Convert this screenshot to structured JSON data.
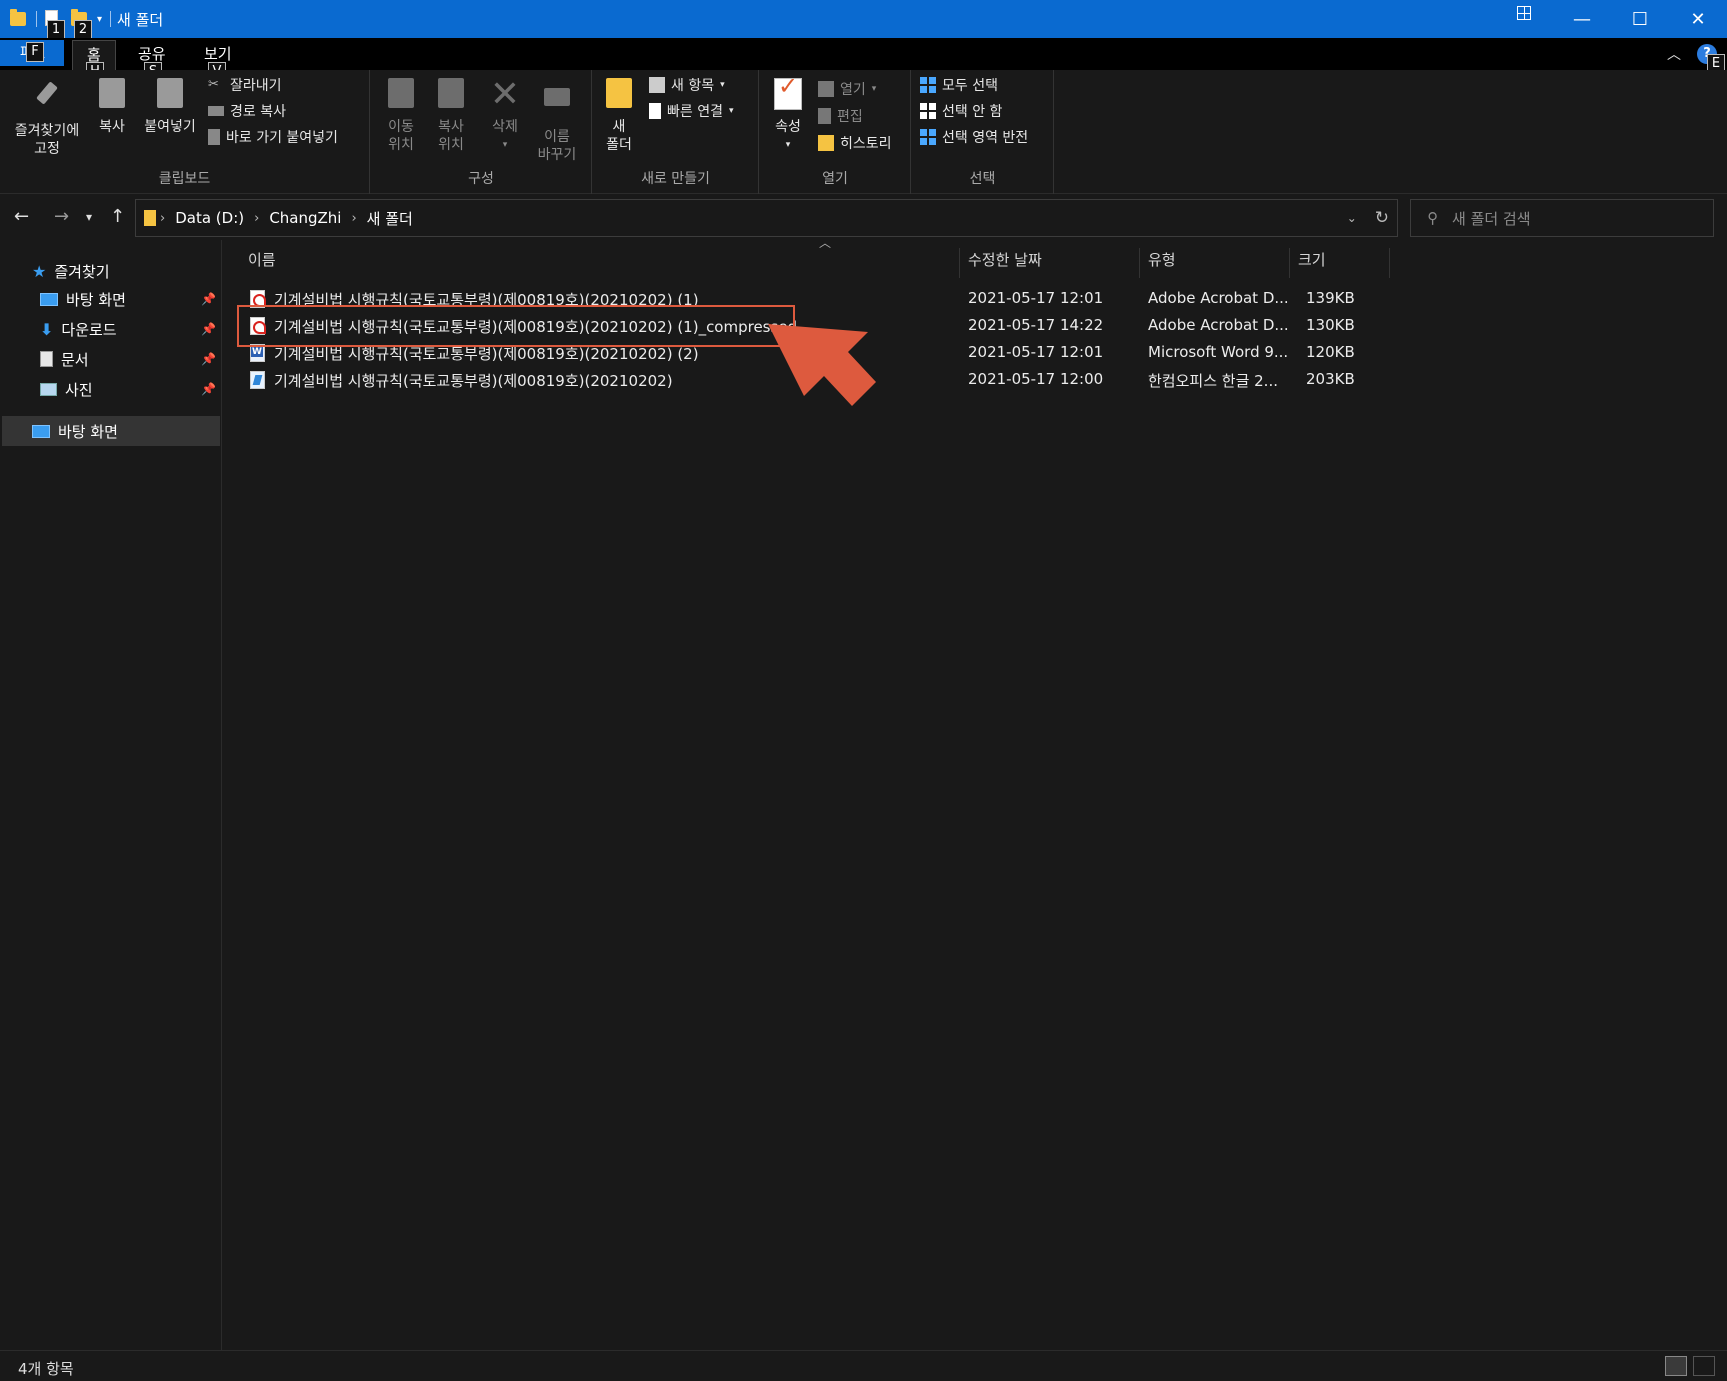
{
  "window": {
    "title": "새 폴더",
    "quick_access_keytips": [
      "1",
      "2"
    ],
    "minimize": "—",
    "maximize": "☐",
    "close": "✕"
  },
  "ribbon_tabs": {
    "file": "파일",
    "file_keytip": "F",
    "tabs": [
      {
        "label": "홈",
        "keytip": "H"
      },
      {
        "label": "공유",
        "keytip": "S"
      },
      {
        "label": "보기",
        "keytip": "V"
      }
    ],
    "collapse_icon": "chevron-up-icon",
    "help_label": "?",
    "help_keytip": "E"
  },
  "ribbon": {
    "clipboard": {
      "label": "클립보드",
      "pin_line1": "즐겨찾기에",
      "pin_line2": "고정",
      "copy": "복사",
      "paste": "붙여넣기",
      "cut": "잘라내기",
      "copy_path": "경로 복사",
      "paste_shortcut": "바로 가기 붙여넣기"
    },
    "organize": {
      "label": "구성",
      "move_line1": "이동",
      "move_line2": "위치",
      "copyto_line1": "복사",
      "copyto_line2": "위치",
      "delete": "삭제",
      "rename_line1": "이름",
      "rename_line2": "바꾸기"
    },
    "new": {
      "label": "새로 만들기",
      "newfolder_line1": "새",
      "newfolder_line2": "폴더",
      "new_item": "새 항목",
      "easy_access": "빠른 연결"
    },
    "open": {
      "label": "열기",
      "properties": "속성",
      "open": "열기",
      "edit": "편집",
      "history": "히스토리"
    },
    "select": {
      "label": "선택",
      "select_all": "모두 선택",
      "select_none": "선택 안 함",
      "invert": "선택 영역 반전"
    }
  },
  "address": {
    "crumbs": [
      "Data (D:)",
      "ChangZhi",
      "새 폴더"
    ],
    "search_placeholder": "새 폴더 검색"
  },
  "nav": {
    "favorites": "즐겨찾기",
    "items": [
      {
        "label": "바탕 화면",
        "icon": "desktop-icon"
      },
      {
        "label": "다운로드",
        "icon": "download-icon"
      },
      {
        "label": "문서",
        "icon": "document-icon"
      },
      {
        "label": "사진",
        "icon": "pictures-icon"
      }
    ],
    "desktop_root": "바탕 화면"
  },
  "columns": {
    "name": "이름",
    "modified": "수정한 날짜",
    "type": "유형",
    "size": "크기"
  },
  "files": [
    {
      "name": "기계설비법 시행규칙(국토교통부령)(제00819호)(20210202) (1)",
      "modified": "2021-05-17 12:01",
      "type": "Adobe Acrobat D...",
      "size": "139KB",
      "icon": "pdf"
    },
    {
      "name": "기계설비법 시행규칙(국토교통부령)(제00819호)(20210202) (1)_compressed",
      "modified": "2021-05-17 14:22",
      "type": "Adobe Acrobat D...",
      "size": "130KB",
      "icon": "pdf"
    },
    {
      "name": "기계설비법 시행규칙(국토교통부령)(제00819호)(20210202) (2)",
      "modified": "2021-05-17 12:01",
      "type": "Microsoft Word 9...",
      "size": "120KB",
      "icon": "word"
    },
    {
      "name": "기계설비법 시행규칙(국토교통부령)(제00819호)(20210202)",
      "modified": "2021-05-17 12:00",
      "type": "한컴오피스 한글 2...",
      "size": "203KB",
      "icon": "hwp"
    }
  ],
  "status": {
    "count": "4개 항목"
  },
  "colors": {
    "accent": "#0a6ad0",
    "annotation": "#dd5a3e"
  }
}
